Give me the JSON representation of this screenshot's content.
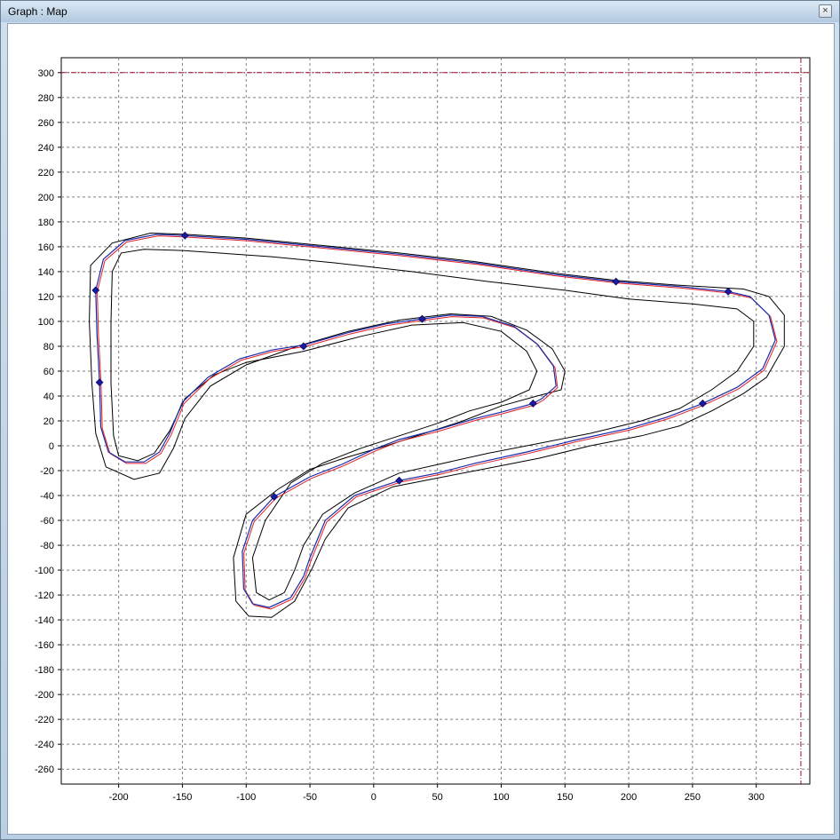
{
  "window": {
    "title": "Graph : Map",
    "close_label": "×"
  },
  "chart_data": {
    "type": "line",
    "title": "",
    "xlabel": "",
    "ylabel": "",
    "xlim": [
      -245,
      342
    ],
    "ylim": [
      -272,
      312
    ],
    "grid": true,
    "x_ticks": [
      -200,
      -150,
      -100,
      -50,
      0,
      50,
      100,
      150,
      200,
      250,
      300
    ],
    "y_ticks": [
      300,
      280,
      260,
      240,
      220,
      200,
      180,
      160,
      140,
      120,
      100,
      80,
      60,
      40,
      20,
      0,
      -20,
      -40,
      -60,
      -80,
      -100,
      -120,
      -140,
      -160,
      -180,
      -200,
      -220,
      -240,
      -260
    ],
    "limit_lines": {
      "y": 300,
      "x": 335,
      "color": "#a01030"
    },
    "colors": {
      "track_edge": "#000000",
      "racing_line_red": "#e0202a",
      "racing_line_blue": "#1a2aa8",
      "markers": "#1a1aa0"
    },
    "racing_line": [
      [
        -148,
        169
      ],
      [
        -170,
        170
      ],
      [
        -195,
        165
      ],
      [
        -212,
        150
      ],
      [
        -218,
        125
      ],
      [
        -217,
        90
      ],
      [
        -215,
        51
      ],
      [
        -214,
        15
      ],
      [
        -208,
        -5
      ],
      [
        -195,
        -13
      ],
      [
        -180,
        -13
      ],
      [
        -168,
        -5
      ],
      [
        -160,
        10
      ],
      [
        -150,
        35
      ],
      [
        -130,
        55
      ],
      [
        -105,
        70
      ],
      [
        -80,
        77
      ],
      [
        -55,
        81
      ],
      [
        -20,
        91
      ],
      [
        10,
        98
      ],
      [
        38,
        102
      ],
      [
        60,
        105
      ],
      [
        85,
        104
      ],
      [
        110,
        96
      ],
      [
        128,
        82
      ],
      [
        141,
        64
      ],
      [
        143,
        48
      ],
      [
        132,
        38
      ],
      [
        125,
        34
      ],
      [
        100,
        27
      ],
      [
        80,
        22
      ],
      [
        50,
        13
      ],
      [
        20,
        5
      ],
      [
        0,
        -3
      ],
      [
        -25,
        -15
      ],
      [
        -50,
        -25
      ],
      [
        -78,
        -41
      ],
      [
        -95,
        -60
      ],
      [
        -103,
        -85
      ],
      [
        -102,
        -115
      ],
      [
        -95,
        -127
      ],
      [
        -82,
        -130
      ],
      [
        -65,
        -122
      ],
      [
        -55,
        -105
      ],
      [
        -50,
        -90
      ],
      [
        -38,
        -60
      ],
      [
        -15,
        -40
      ],
      [
        20,
        -28
      ],
      [
        50,
        -22
      ],
      [
        80,
        -14
      ],
      [
        120,
        -5
      ],
      [
        160,
        5
      ],
      [
        200,
        14
      ],
      [
        230,
        23
      ],
      [
        258,
        34
      ],
      [
        285,
        47
      ],
      [
        305,
        62
      ],
      [
        315,
        85
      ],
      [
        310,
        105
      ],
      [
        295,
        120
      ],
      [
        278,
        124
      ],
      [
        240,
        128
      ],
      [
        190,
        132
      ],
      [
        140,
        138
      ],
      [
        80,
        147
      ],
      [
        20,
        154
      ],
      [
        -40,
        160
      ],
      [
        -100,
        166
      ],
      [
        -148,
        169
      ]
    ],
    "markers": [
      [
        -148,
        169
      ],
      [
        -218,
        125
      ],
      [
        -215,
        51
      ],
      [
        -55,
        80
      ],
      [
        38,
        102
      ],
      [
        125,
        34
      ],
      [
        -78,
        -41
      ],
      [
        20,
        -28
      ],
      [
        258,
        34
      ],
      [
        278,
        124
      ],
      [
        190,
        132
      ]
    ],
    "outer_edge": [
      [
        -148,
        170
      ],
      [
        -175,
        171
      ],
      [
        -205,
        163
      ],
      [
        -222,
        145
      ],
      [
        -223,
        100
      ],
      [
        -221,
        50
      ],
      [
        -218,
        10
      ],
      [
        -210,
        -17
      ],
      [
        -188,
        -27
      ],
      [
        -168,
        -22
      ],
      [
        -157,
        -2
      ],
      [
        -148,
        22
      ],
      [
        -128,
        48
      ],
      [
        -100,
        65
      ],
      [
        -60,
        80
      ],
      [
        -20,
        92
      ],
      [
        20,
        101
      ],
      [
        60,
        106
      ],
      [
        92,
        104
      ],
      [
        120,
        93
      ],
      [
        140,
        78
      ],
      [
        150,
        60
      ],
      [
        147,
        45
      ],
      [
        128,
        40
      ],
      [
        100,
        32
      ],
      [
        70,
        20
      ],
      [
        40,
        10
      ],
      [
        10,
        0
      ],
      [
        -20,
        -9
      ],
      [
        -50,
        -19
      ],
      [
        -75,
        -35
      ],
      [
        -100,
        -55
      ],
      [
        -110,
        -90
      ],
      [
        -108,
        -125
      ],
      [
        -98,
        -137
      ],
      [
        -80,
        -138
      ],
      [
        -62,
        -125
      ],
      [
        -48,
        -98
      ],
      [
        -38,
        -75
      ],
      [
        -20,
        -50
      ],
      [
        15,
        -33
      ],
      [
        50,
        -26
      ],
      [
        90,
        -18
      ],
      [
        130,
        -10
      ],
      [
        170,
        0
      ],
      [
        210,
        8
      ],
      [
        240,
        16
      ],
      [
        265,
        28
      ],
      [
        290,
        42
      ],
      [
        308,
        55
      ],
      [
        322,
        80
      ],
      [
        322,
        105
      ],
      [
        310,
        120
      ],
      [
        290,
        126
      ],
      [
        240,
        129
      ],
      [
        190,
        133
      ],
      [
        140,
        139
      ],
      [
        80,
        148
      ],
      [
        20,
        155
      ],
      [
        -40,
        161
      ],
      [
        -100,
        167
      ],
      [
        -148,
        170
      ]
    ],
    "inner_edge": [
      [
        -150,
        157
      ],
      [
        -180,
        158
      ],
      [
        -198,
        155
      ],
      [
        -205,
        140
      ],
      [
        -206,
        100
      ],
      [
        -206,
        50
      ],
      [
        -204,
        8
      ],
      [
        -200,
        -8
      ],
      [
        -185,
        -12
      ],
      [
        -172,
        -6
      ],
      [
        -160,
        12
      ],
      [
        -148,
        38
      ],
      [
        -125,
        57
      ],
      [
        -100,
        67
      ],
      [
        -55,
        76
      ],
      [
        -10,
        88
      ],
      [
        30,
        97
      ],
      [
        70,
        99
      ],
      [
        100,
        92
      ],
      [
        120,
        76
      ],
      [
        128,
        60
      ],
      [
        122,
        45
      ],
      [
        100,
        35
      ],
      [
        75,
        28
      ],
      [
        50,
        18
      ],
      [
        20,
        8
      ],
      [
        -10,
        -2
      ],
      [
        -40,
        -14
      ],
      [
        -65,
        -30
      ],
      [
        -85,
        -60
      ],
      [
        -95,
        -90
      ],
      [
        -92,
        -118
      ],
      [
        -82,
        -124
      ],
      [
        -70,
        -118
      ],
      [
        -62,
        -100
      ],
      [
        -55,
        -80
      ],
      [
        -40,
        -55
      ],
      [
        -15,
        -38
      ],
      [
        20,
        -22
      ],
      [
        55,
        -14
      ],
      [
        90,
        -6
      ],
      [
        130,
        2
      ],
      [
        170,
        10
      ],
      [
        210,
        20
      ],
      [
        240,
        30
      ],
      [
        265,
        45
      ],
      [
        285,
        60
      ],
      [
        298,
        80
      ],
      [
        298,
        100
      ],
      [
        285,
        110
      ],
      [
        250,
        114
      ],
      [
        200,
        118
      ],
      [
        150,
        125
      ],
      [
        90,
        132
      ],
      [
        30,
        140
      ],
      [
        -30,
        147
      ],
      [
        -80,
        152
      ],
      [
        -150,
        157
      ]
    ]
  }
}
